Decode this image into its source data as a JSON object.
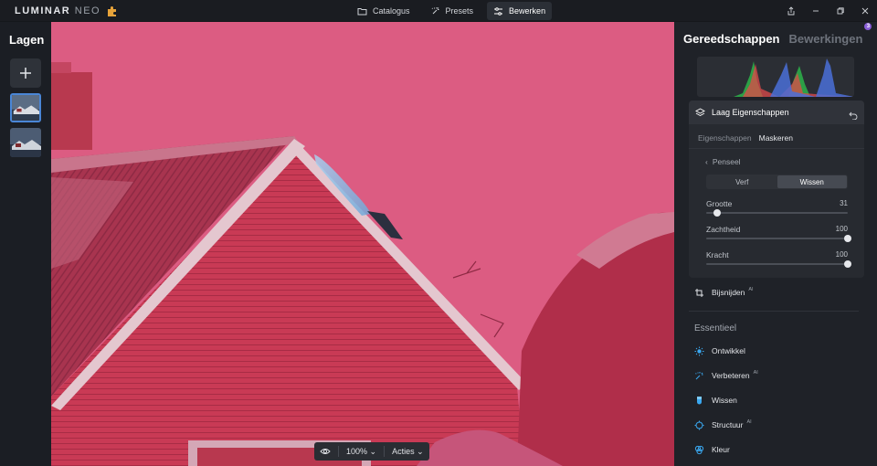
{
  "app": {
    "logo_main": "LUMINAR",
    "logo_sub": "NEO"
  },
  "nav": {
    "tabs": [
      {
        "label": "Catalogus",
        "icon": "folder-icon"
      },
      {
        "label": "Presets",
        "icon": "sparkle-icon"
      },
      {
        "label": "Bewerken",
        "icon": "sliders-icon",
        "active": true
      }
    ]
  },
  "layers": {
    "title": "Lagen"
  },
  "canvas": {
    "zoom": "100%",
    "actions_label": "Acties"
  },
  "right_panel": {
    "tab_active": "Gereedschappen",
    "tab_inactive": "Bewerkingen",
    "badge_count": "3",
    "layer_props": {
      "title": "Laag Eigenschappen",
      "subtabs": [
        "Eigenschappen",
        "Maskeren"
      ],
      "active_subtab": "Maskeren",
      "brush_back_label": "Penseel",
      "segment": [
        "Verf",
        "Wissen"
      ],
      "segment_active": "Wissen",
      "sliders": [
        {
          "label": "Grootte",
          "value": "31",
          "fraction": 0.08
        },
        {
          "label": "Zachtheid",
          "value": "100",
          "fraction": 1.0
        },
        {
          "label": "Kracht",
          "value": "100",
          "fraction": 1.0
        }
      ]
    },
    "crop_label": "Bijsnijden",
    "ai_tag": "AI",
    "section_title": "Essentieel",
    "tools": [
      {
        "label": "Ontwikkel",
        "icon": "sun-icon",
        "ai": false
      },
      {
        "label": "Verbeteren",
        "icon": "sparkle-icon",
        "ai": true
      },
      {
        "label": "Wissen",
        "icon": "eraser-icon",
        "ai": false
      },
      {
        "label": "Structuur",
        "icon": "structure-icon",
        "ai": true
      },
      {
        "label": "Kleur",
        "icon": "color-icon",
        "ai": false
      }
    ]
  },
  "colors": {
    "accent": "#4a86d6",
    "mask_overlay": "#d85a7f",
    "tool_icon": "#3aa8f0"
  }
}
